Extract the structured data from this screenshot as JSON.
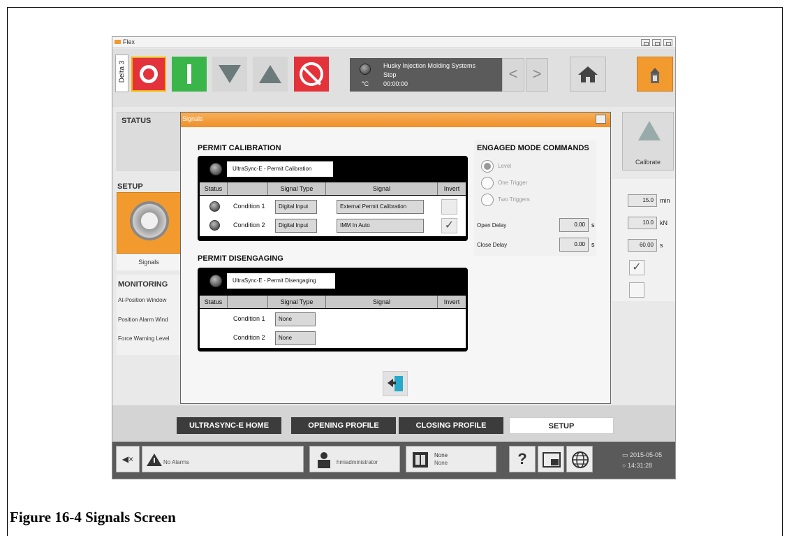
{
  "app": {
    "window_title": "Flex",
    "machine_tab": "Delta 3",
    "status": {
      "line1": "Husky Injection Molding Systems",
      "line2": "Stop",
      "line3": "00:00:00",
      "unit": "°C"
    },
    "nav_prev": "<",
    "nav_next": ">"
  },
  "left": {
    "status_title": "STATUS",
    "setup_title": "SETUP",
    "signals_label": "Signals",
    "monitoring_title": "MONITORING",
    "monitoring_items": [
      "At-Position Window",
      "Position Alarm Wind",
      "Force Warning Level"
    ]
  },
  "right": {
    "calibrate_label": "Calibrate",
    "values": [
      {
        "value": "15.0",
        "unit": "min"
      },
      {
        "value": "10.0",
        "unit": "kN"
      },
      {
        "value": "60.00",
        "unit": "s"
      }
    ],
    "check1": "✓",
    "check2": ""
  },
  "dialog": {
    "title": "Signals",
    "permit_calibration": {
      "title": "PERMIT CALIBRATION",
      "name": "UltraSync-E - Permit Calibration",
      "headers": [
        "Status",
        "",
        "Signal Type",
        "Signal",
        "Invert"
      ],
      "rows": [
        {
          "condition": "Condition 1",
          "type": "Digital Input",
          "signal": "External Permit Calibration",
          "invert": ""
        },
        {
          "condition": "Condition 2",
          "type": "Digital Input",
          "signal": "IMM In Auto",
          "invert": "✓"
        }
      ]
    },
    "permit_disengaging": {
      "title": "PERMIT DISENGAGING",
      "name": "UltraSync-E - Permit Disengaging",
      "headers": [
        "Status",
        "",
        "Signal Type",
        "Signal",
        "Invert"
      ],
      "rows": [
        {
          "condition": "Condition 1",
          "type": "None"
        },
        {
          "condition": "Condition 2",
          "type": "None"
        }
      ]
    },
    "engaged_mode": {
      "title": "ENGAGED MODE COMMANDS",
      "options": [
        "Level",
        "One Trigger",
        "Two Triggers"
      ],
      "selected": "Level",
      "open_delay_label": "Open Delay",
      "open_delay_value": "0.00",
      "close_delay_label": "Close Delay",
      "close_delay_value": "0.00",
      "delay_unit": "s"
    }
  },
  "tabs": [
    "ULTRASYNC-E HOME",
    "OPENING PROFILE",
    "CLOSING PROFILE",
    "SETUP"
  ],
  "statusbar": {
    "alarms": "No Alarms",
    "user": "hmiadministrator",
    "mold_line1": "None",
    "mold_line2": "None",
    "help": "?",
    "date": "2015-05-05",
    "time": "14:31:28"
  },
  "caption": "Figure 16-4  Signals Screen",
  "colors": {
    "accent": "#f29a2e",
    "stop": "#e3323a",
    "start": "#3ab54a"
  }
}
